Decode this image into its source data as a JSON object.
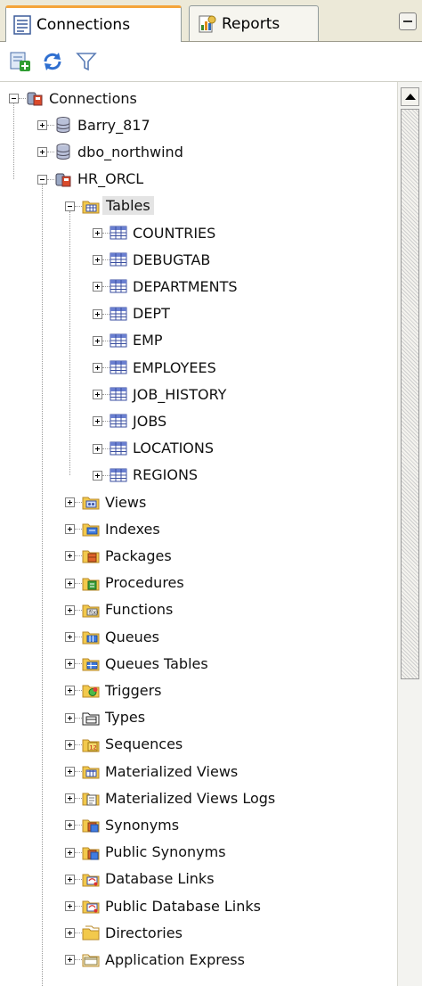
{
  "tabs": {
    "connections": "Connections",
    "reports": "Reports"
  },
  "toolbar": {
    "buttons": [
      "add-connection-icon",
      "refresh-icon",
      "filter-icon"
    ]
  },
  "tree": {
    "root": "Connections",
    "connections": [
      "Barry_817",
      "dbo_northwind",
      "HR_ORCL"
    ],
    "categories": {
      "tables": "Tables",
      "items": [
        "Views",
        "Indexes",
        "Packages",
        "Procedures",
        "Functions",
        "Queues",
        "Queues Tables",
        "Triggers",
        "Types",
        "Sequences",
        "Materialized Views",
        "Materialized Views Logs",
        "Synonyms",
        "Public Synonyms",
        "Database Links",
        "Public Database Links",
        "Directories",
        "Application Express"
      ]
    },
    "tables": [
      "COUNTRIES",
      "DEBUGTAB",
      "DEPARTMENTS",
      "DEPT",
      "EMP",
      "EMPLOYEES",
      "JOB_HISTORY",
      "JOBS",
      "LOCATIONS",
      "REGIONS"
    ]
  },
  "colors": {
    "selected_bg": "#e4e4e4",
    "tab_accent": "#f4a43a",
    "chrome_bg": "#ece9d8"
  }
}
